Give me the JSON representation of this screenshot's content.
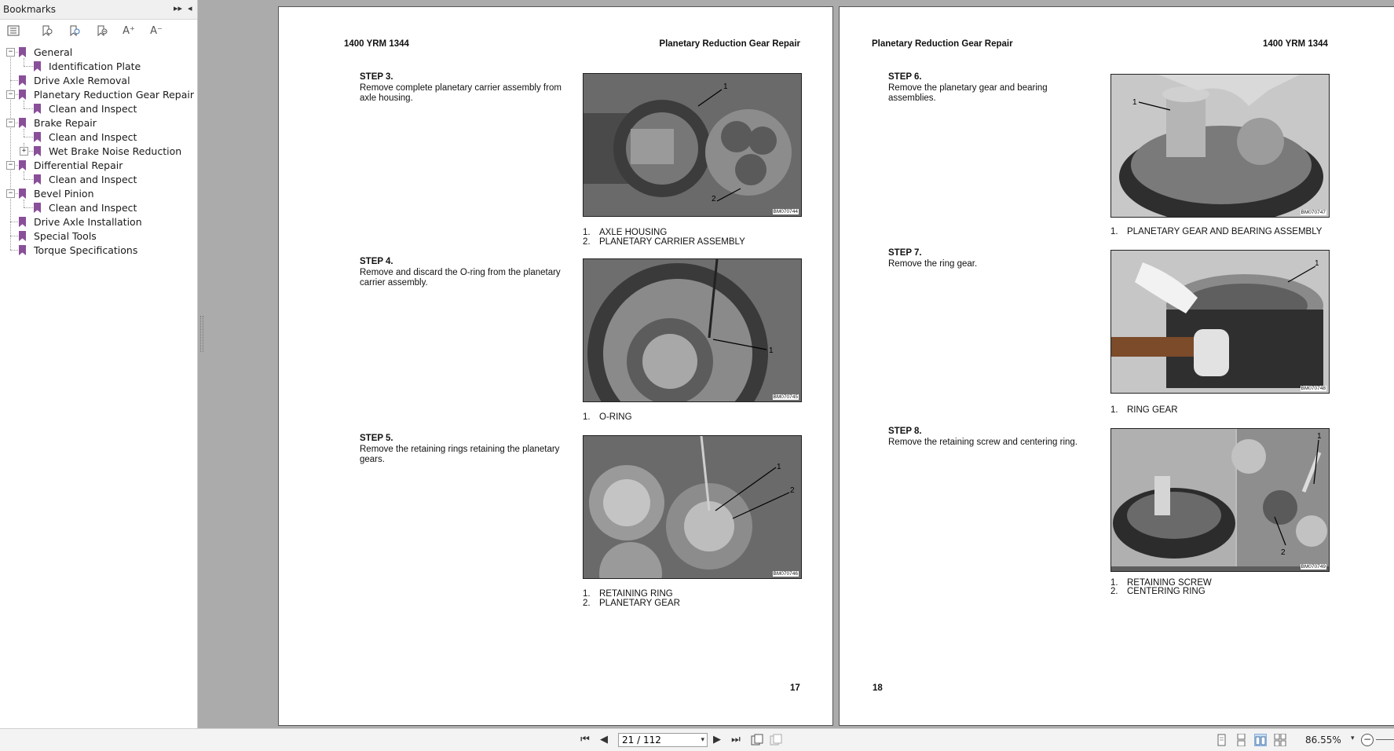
{
  "sidebar": {
    "title": "Bookmarks",
    "header_buttons": {
      "options": "▸▸",
      "collapse": "◂"
    },
    "toolbar_icons": [
      "list-options-icon",
      "bookmark-expand-icon",
      "bookmark-add-icon",
      "bookmark-delete-icon",
      "text-size-increase-icon",
      "text-size-decrease-icon"
    ],
    "toolbar_glyphs": {
      "text_plus": "A⁺",
      "text_minus": "A⁻"
    },
    "items": [
      {
        "label": "General",
        "expander": "−"
      },
      {
        "label": "Identification Plate",
        "expander": ""
      },
      {
        "label": "Drive Axle Removal",
        "expander": ""
      },
      {
        "label": "Planetary Reduction Gear Repair",
        "expander": "−"
      },
      {
        "label": "Clean and Inspect",
        "expander": ""
      },
      {
        "label": "Brake Repair",
        "expander": "−"
      },
      {
        "label": "Clean and Inspect",
        "expander": ""
      },
      {
        "label": "Wet Brake Noise Reduction",
        "expander": "+"
      },
      {
        "label": "Differential Repair",
        "expander": "−"
      },
      {
        "label": "Clean and Inspect",
        "expander": ""
      },
      {
        "label": "Bevel Pinion",
        "expander": "−"
      },
      {
        "label": "Clean and Inspect",
        "expander": ""
      },
      {
        "label": "Drive Axle Installation",
        "expander": ""
      },
      {
        "label": "Special Tools",
        "expander": ""
      },
      {
        "label": "Torque Specifications",
        "expander": ""
      }
    ]
  },
  "left_page": {
    "header_left": "1400 YRM 1344",
    "header_right": "Planetary Reduction Gear Repair",
    "page_number": "17",
    "steps": [
      {
        "title": "STEP 3.",
        "text": "Remove complete planetary carrier assembly from axle housing.",
        "photo_id": "BM070744",
        "callouts": [
          "1",
          "2"
        ],
        "captions": [
          {
            "n": "1.",
            "t": "AXLE HOUSING"
          },
          {
            "n": "2.",
            "t": "PLANETARY CARRIER ASSEMBLY"
          }
        ]
      },
      {
        "title": "STEP 4.",
        "text": "Remove and discard the O-ring from the planetary carrier assembly.",
        "photo_id": "BM070745",
        "callouts": [
          "1"
        ],
        "captions": [
          {
            "n": "1.",
            "t": "O-RING"
          }
        ]
      },
      {
        "title": "STEP 5.",
        "text": "Remove the retaining rings retaining the planetary gears.",
        "photo_id": "BM070746",
        "callouts": [
          "1",
          "2"
        ],
        "captions": [
          {
            "n": "1.",
            "t": "RETAINING RING"
          },
          {
            "n": "2.",
            "t": "PLANETARY GEAR"
          }
        ]
      }
    ]
  },
  "right_page": {
    "header_left": "Planetary Reduction Gear Repair",
    "header_right": "1400 YRM 1344",
    "page_number": "18",
    "steps": [
      {
        "title": "STEP 6.",
        "text": "Remove the planetary gear and bearing assemblies.",
        "photo_id": "BM070747",
        "callouts": [
          "1"
        ],
        "captions": [
          {
            "n": "1.",
            "t": "PLANETARY GEAR AND BEARING ASSEMBLY"
          }
        ]
      },
      {
        "title": "STEP 7.",
        "text": "Remove the ring gear.",
        "photo_id": "BM070748",
        "callouts": [
          "1"
        ],
        "captions": [
          {
            "n": "1.",
            "t": "RING GEAR"
          }
        ]
      },
      {
        "title": "STEP 8.",
        "text": "Remove the retaining screw and centering ring.",
        "photo_id": "BM070749",
        "callouts": [
          "1",
          "2"
        ],
        "captions": [
          {
            "n": "1.",
            "t": "RETAINING SCREW"
          },
          {
            "n": "2.",
            "t": "CENTERING RING"
          }
        ]
      }
    ]
  },
  "bottom_bar": {
    "nav_glyphs": {
      "first": "⏮",
      "prev": "◀",
      "next": "▶",
      "last": "⏭"
    },
    "page_indicator": "21 / 112",
    "dropdown_glyph": "▾",
    "zoom": "86.55%",
    "zoom_minus": "−",
    "view_modes": [
      "single-page-icon",
      "continuous-icon",
      "two-page-icon",
      "two-page-continuous-icon"
    ],
    "active_view": "two-page-icon"
  },
  "colors": {
    "viewer_background": "#ababab",
    "bookmark_purple": "#8a4f99",
    "active_view_highlight": "#c9dcf2"
  }
}
